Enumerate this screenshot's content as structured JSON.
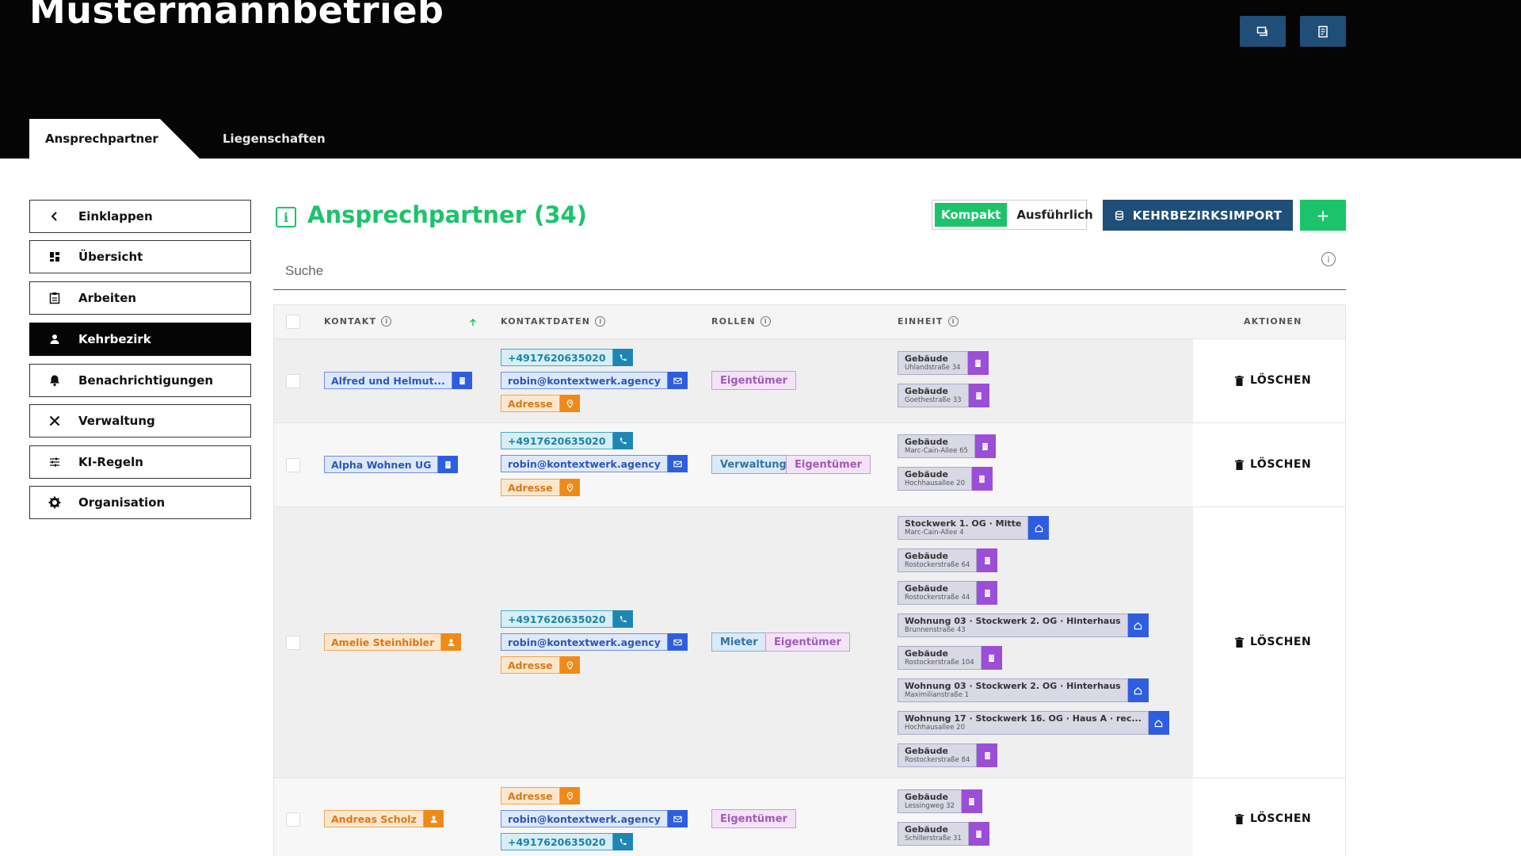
{
  "header": {
    "company": "Mustermannbetrieb",
    "buttons": [
      {
        "icon": "chat-icon"
      },
      {
        "icon": "document-icon"
      }
    ],
    "tabs": [
      {
        "label": "Ansprechpartner",
        "active": true
      },
      {
        "label": "Liegenschaften",
        "active": false
      }
    ]
  },
  "sidebar": {
    "items": [
      {
        "label": "Einklappen",
        "icon": "chevron-left-icon",
        "active": false
      },
      {
        "label": "Übersicht",
        "icon": "dashboard-icon",
        "active": false
      },
      {
        "label": "Arbeiten",
        "icon": "clipboard-icon",
        "active": false
      },
      {
        "label": "Kehrbezirk",
        "icon": "person-icon",
        "active": true
      },
      {
        "label": "Benachrichtigungen",
        "icon": "bell-icon",
        "active": false
      },
      {
        "label": "Verwaltung",
        "icon": "tools-icon",
        "active": false
      },
      {
        "label": "KI-Regeln",
        "icon": "sliders-icon",
        "active": false
      },
      {
        "label": "Organisation",
        "icon": "gear-icon",
        "active": false
      }
    ]
  },
  "main": {
    "title": "Ansprechpartner (34)",
    "view_toggle": {
      "compact": "Kompakt",
      "detailed": "Ausführlich",
      "selected": "Kompakt"
    },
    "import_button": "KEHRBEZIRKSIMPORT",
    "add_button": "+",
    "search": {
      "placeholder": "Suche",
      "value": ""
    },
    "table": {
      "columns": [
        "KONTAKT",
        "KONTAKTDATEN",
        "ROLLEN",
        "EINHEIT",
        "AKTIONEN"
      ],
      "delete_label": "LÖSCHEN",
      "rows": [
        {
          "contact": "Alfred und Helmut...",
          "contact_type": "building",
          "details": [
            {
              "type": "phone",
              "value": "+4917620635020"
            },
            {
              "type": "mail",
              "value": "robin@kontextwerk.agency"
            },
            {
              "type": "address",
              "value": "Adresse"
            }
          ],
          "roles": [
            "Eigentümer"
          ],
          "units": [
            {
              "kind": "building",
              "title": "Gebäude",
              "sub": "Uhlandstraße 34"
            },
            {
              "kind": "building",
              "title": "Gebäude",
              "sub": "Goethestraße 33"
            }
          ]
        },
        {
          "contact": "Alpha Wohnen UG",
          "contact_type": "building",
          "details": [
            {
              "type": "phone",
              "value": "+4917620635020"
            },
            {
              "type": "mail",
              "value": "robin@kontextwerk.agency"
            },
            {
              "type": "address",
              "value": "Adresse"
            }
          ],
          "roles": [
            "Verwaltung",
            "Eigentümer"
          ],
          "units": [
            {
              "kind": "building",
              "title": "Gebäude",
              "sub": "Marc-Cain-Allee 65"
            },
            {
              "kind": "building",
              "title": "Gebäude",
              "sub": "Hochhausallee 20"
            }
          ]
        },
        {
          "contact": "Amelie Steinhibler",
          "contact_type": "person",
          "details": [
            {
              "type": "phone",
              "value": "+4917620635020"
            },
            {
              "type": "mail",
              "value": "robin@kontextwerk.agency"
            },
            {
              "type": "address",
              "value": "Adresse"
            }
          ],
          "roles": [
            "Mieter",
            "Eigentümer"
          ],
          "units": [
            {
              "kind": "home",
              "title": "Stockwerk 1. OG · Mitte",
              "sub": "Marc-Cain-Allee 4"
            },
            {
              "kind": "building",
              "title": "Gebäude",
              "sub": "Rostockerstraße 64"
            },
            {
              "kind": "building",
              "title": "Gebäude",
              "sub": "Rostockerstraße 44"
            },
            {
              "kind": "home",
              "title": "Wohnung 03 · Stockwerk 2. OG · Hinterhaus",
              "sub": "Brunnenstraße 43"
            },
            {
              "kind": "building",
              "title": "Gebäude",
              "sub": "Rostockerstraße 104"
            },
            {
              "kind": "home",
              "title": "Wohnung 03 · Stockwerk 2. OG · Hinterhaus",
              "sub": "Maximilianstraße 1"
            },
            {
              "kind": "home",
              "title": "Wohnung 17 · Stockwerk 16. OG · Haus A · rec...",
              "sub": "Hochhausallee 20"
            },
            {
              "kind": "building",
              "title": "Gebäude",
              "sub": "Rostockerstraße 84"
            }
          ]
        },
        {
          "contact": "Andreas Scholz",
          "contact_type": "person",
          "details": [
            {
              "type": "address",
              "value": "Adresse"
            },
            {
              "type": "mail",
              "value": "robin@kontextwerk.agency"
            },
            {
              "type": "phone",
              "value": "+4917620635020"
            }
          ],
          "roles": [
            "Eigentümer"
          ],
          "units": [
            {
              "kind": "building",
              "title": "Gebäude",
              "sub": "Lessingweg 32"
            },
            {
              "kind": "building",
              "title": "Gebäude",
              "sub": "Schillerstraße 31"
            }
          ]
        }
      ]
    }
  },
  "colors": {
    "accent_green": "#1bc46a",
    "primary_blue": "#1f4e79",
    "header_bg": "#050505"
  }
}
